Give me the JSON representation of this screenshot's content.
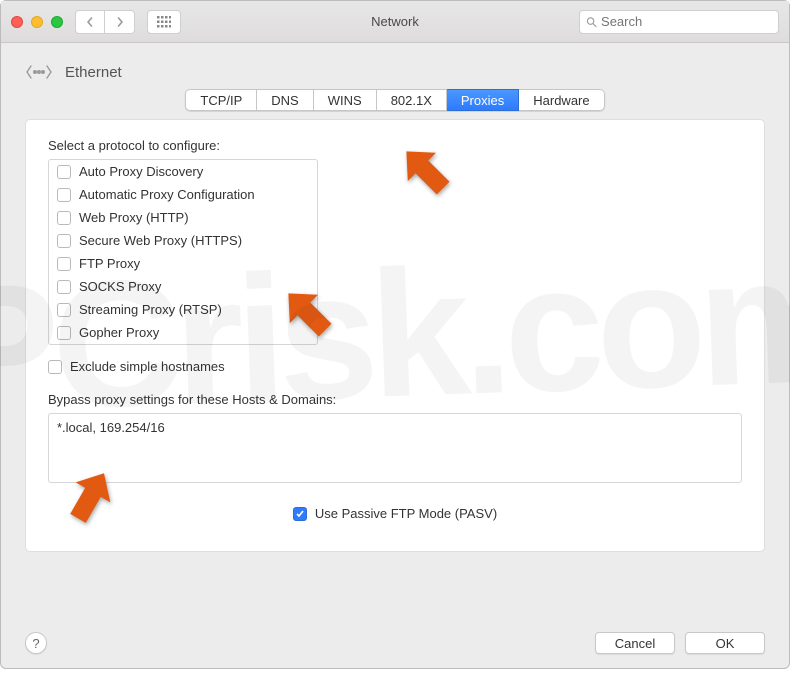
{
  "window": {
    "title": "Network",
    "search_placeholder": "Search"
  },
  "header": {
    "interface": "Ethernet"
  },
  "tabs": [
    {
      "label": "TCP/IP",
      "active": false
    },
    {
      "label": "DNS",
      "active": false
    },
    {
      "label": "WINS",
      "active": false
    },
    {
      "label": "802.1X",
      "active": false
    },
    {
      "label": "Proxies",
      "active": true
    },
    {
      "label": "Hardware",
      "active": false
    }
  ],
  "panel": {
    "select_label": "Select a protocol to configure:",
    "protocols": [
      {
        "label": "Auto Proxy Discovery",
        "checked": false
      },
      {
        "label": "Automatic Proxy Configuration",
        "checked": false
      },
      {
        "label": "Web Proxy (HTTP)",
        "checked": false
      },
      {
        "label": "Secure Web Proxy (HTTPS)",
        "checked": false
      },
      {
        "label": "FTP Proxy",
        "checked": false
      },
      {
        "label": "SOCKS Proxy",
        "checked": false
      },
      {
        "label": "Streaming Proxy (RTSP)",
        "checked": false
      },
      {
        "label": "Gopher Proxy",
        "checked": false
      }
    ],
    "exclude_label": "Exclude simple hostnames",
    "exclude_checked": false,
    "bypass_label": "Bypass proxy settings for these Hosts & Domains:",
    "bypass_value": "*.local, 169.254/16",
    "pasv_label": "Use Passive FTP Mode (PASV)",
    "pasv_checked": true
  },
  "footer": {
    "help": "?",
    "cancel": "Cancel",
    "ok": "OK"
  },
  "watermark": "PCrisk.com"
}
